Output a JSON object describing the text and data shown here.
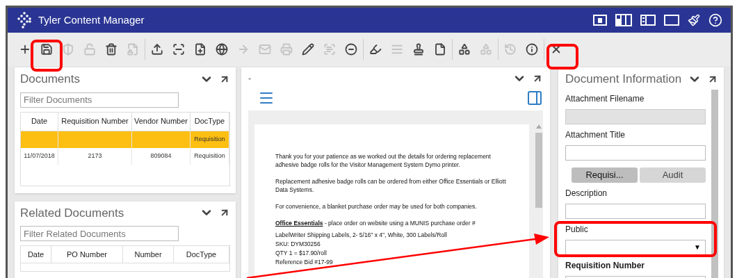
{
  "window": {
    "title": "Tyler Content Manager"
  },
  "toolbar": {
    "groups": [
      [
        {
          "disabled": false
        },
        {
          "disabled": false
        },
        {
          "disabled": true
        },
        {
          "disabled": true
        },
        {
          "disabled": false
        },
        {
          "disabled": true
        }
      ],
      [
        {
          "disabled": false
        },
        {
          "disabled": false
        },
        {
          "disabled": false
        },
        {
          "disabled": false
        },
        {
          "disabled": true
        },
        {
          "disabled": true
        },
        {
          "disabled": true
        },
        {
          "disabled": false
        },
        {
          "disabled": true
        },
        {
          "disabled": false
        }
      ],
      [
        {
          "disabled": false
        },
        {
          "disabled": true
        },
        {
          "disabled": false
        },
        {
          "disabled": false
        }
      ],
      [
        {
          "disabled": false
        },
        {
          "disabled": true
        }
      ],
      [
        {
          "disabled": true
        },
        {
          "disabled": false
        }
      ],
      [
        {
          "disabled": false
        }
      ]
    ]
  },
  "documents": {
    "title": "Documents",
    "filter_placeholder": "Filter Documents",
    "columns": [
      "Date",
      "Requisition Number",
      "Vendor Number",
      "DocType"
    ],
    "rows": [
      {
        "selected": true,
        "doc_type": "Requisition"
      },
      {
        "selected": false,
        "date": "11/07/2018",
        "requisition_number": "2173",
        "vendor_number": "809084",
        "doc_type": "Requisition"
      }
    ]
  },
  "related_documents": {
    "title": "Related Documents",
    "filter_placeholder": "Filter Related Documents",
    "columns": [
      "Date",
      "PO Number",
      "Number",
      "DocType"
    ]
  },
  "viewer": {
    "title": "-",
    "paragraphs": [
      "Thank you for your patience as we worked out the details for ordering replacement adhesive badge rolls for the Visitor Management System Dymo printer.",
      "Replacement adhesive badge rolls can be ordered from either Office Essentials or Elliott Data Systems.",
      "For convenience, a blanket purchase order may be used for both companies."
    ],
    "vendor_heading": "Office Essentials",
    "vendor_text": " - place order on website using a MUNIS purchase order #",
    "lines": [
      "LabelWriter Shipping Labels, 2- 5/16\" x 4\", White, 300 Labels/Roll",
      "SKU: DYM30256",
      "QTY 1 = $17.90/roll",
      "Reference Bid #17-99"
    ]
  },
  "document_information": {
    "title": "Document Information",
    "fields_top": [
      {
        "label": "Attachment Filename",
        "disabled": true
      },
      {
        "label": "Attachment Title",
        "disabled": false
      }
    ],
    "tabs": [
      {
        "label": "Requisi...",
        "selected": true
      },
      {
        "label": "Audit",
        "selected": false
      }
    ],
    "fields_bottom": [
      {
        "label": "Description",
        "kind": "text"
      },
      {
        "label": "Public",
        "kind": "select",
        "caret": "▼"
      },
      {
        "label": "Requisition Number",
        "kind": "text"
      }
    ]
  }
}
